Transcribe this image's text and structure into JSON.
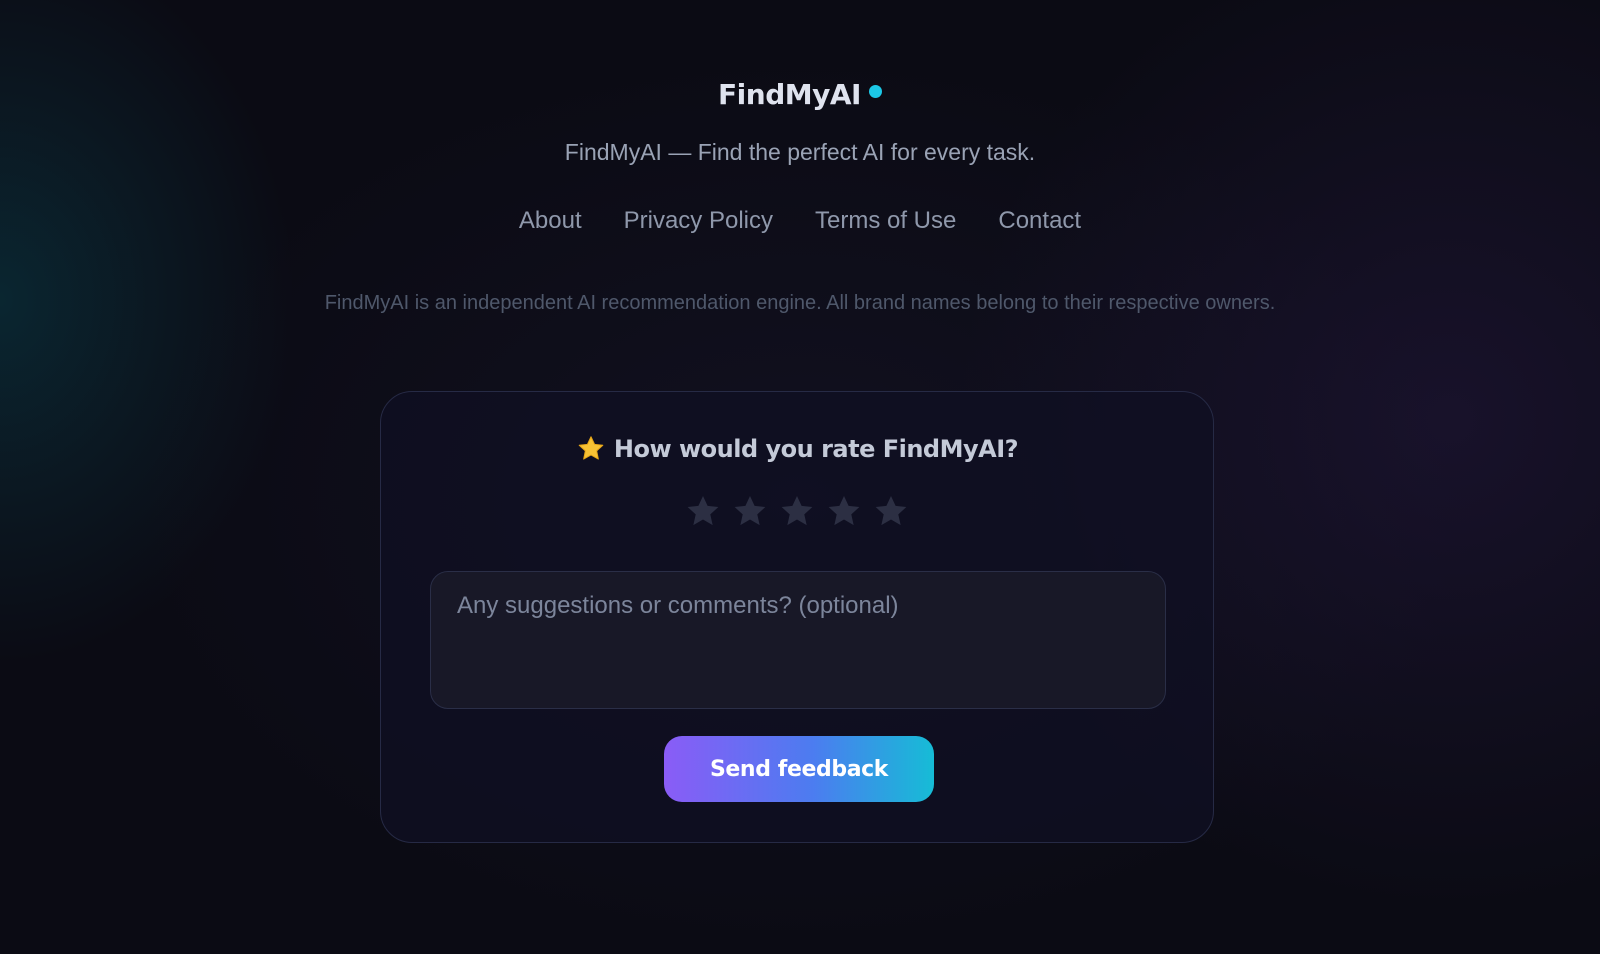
{
  "brand": {
    "name": "FindMyAI",
    "dot_color": "#1cc8e6"
  },
  "tagline": "FindMyAI — Find the perfect AI for every task.",
  "nav": {
    "items": [
      {
        "label": "About"
      },
      {
        "label": "Privacy Policy"
      },
      {
        "label": "Terms of Use"
      },
      {
        "label": "Contact"
      }
    ]
  },
  "disclaimer": "FindMyAI is an independent AI recommendation engine. All brand names belong to their respective owners.",
  "feedback": {
    "title_icon": "star-emoji-icon",
    "title": "How would you rate FindMyAI?",
    "rating": {
      "value": 0,
      "max": 5,
      "star_color": "#2c2f43"
    },
    "comment_placeholder": "Any suggestions or comments? (optional)",
    "comment_value": "",
    "submit_label": "Send feedback"
  },
  "colors": {
    "background": "#0b0b14",
    "accent_start": "#8a5cf6",
    "accent_end": "#16bcd6"
  }
}
